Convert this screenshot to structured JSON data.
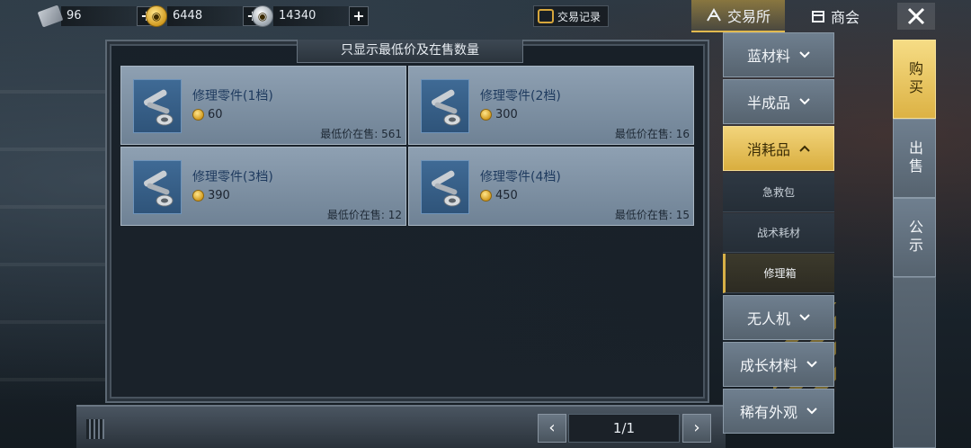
{
  "topbar": {
    "currencies": [
      {
        "icon": "ticket-icon",
        "value": "96"
      },
      {
        "icon": "gold-coin-icon",
        "value": "6448"
      },
      {
        "icon": "silver-coin-icon",
        "value": "14340"
      }
    ],
    "plus_label": "+",
    "trade_log_label": "交易记录",
    "tabs": [
      {
        "icon": "exchange-icon",
        "label": "交易所",
        "active": true
      },
      {
        "icon": "shop-icon",
        "label": "商会",
        "active": false
      }
    ],
    "close_icon": "close-icon"
  },
  "panel": {
    "header": "只显示最低价及在售数量",
    "items": [
      {
        "name": "修理零件(1档)",
        "price": "60",
        "stock_label": "最低价在售:",
        "stock": "561",
        "icon": "repair-parts-icon"
      },
      {
        "name": "修理零件(2档)",
        "price": "300",
        "stock_label": "最低价在售:",
        "stock": "16",
        "icon": "repair-parts-icon"
      },
      {
        "name": "修理零件(3档)",
        "price": "390",
        "stock_label": "最低价在售:",
        "stock": "12",
        "icon": "repair-parts-icon"
      },
      {
        "name": "修理零件(4档)",
        "price": "450",
        "stock_label": "最低价在售:",
        "stock": "15",
        "icon": "repair-parts-icon"
      }
    ],
    "pager": {
      "prev": "‹",
      "page": "1/1",
      "next": "›"
    }
  },
  "categories": {
    "items": [
      {
        "label": "蓝材料",
        "state": "collapsed"
      },
      {
        "label": "半成品",
        "state": "collapsed"
      },
      {
        "label": "消耗品",
        "state": "expanded"
      },
      {
        "label": "无人机",
        "state": "collapsed"
      },
      {
        "label": "成长材料",
        "state": "collapsed"
      },
      {
        "label": "稀有外观",
        "state": "collapsed"
      }
    ],
    "subitems": [
      {
        "label": "急救包",
        "active": false
      },
      {
        "label": "战术耗材",
        "active": false
      },
      {
        "label": "修理箱",
        "active": true
      }
    ]
  },
  "side_tabs": [
    {
      "label": "购买",
      "active": true
    },
    {
      "label": "出售",
      "active": false
    },
    {
      "label": "公示",
      "active": false
    }
  ],
  "colors": {
    "accent_gold": "#e1b94f",
    "item_name": "#1e3a5e",
    "card_bg": "#8ea0b2"
  }
}
